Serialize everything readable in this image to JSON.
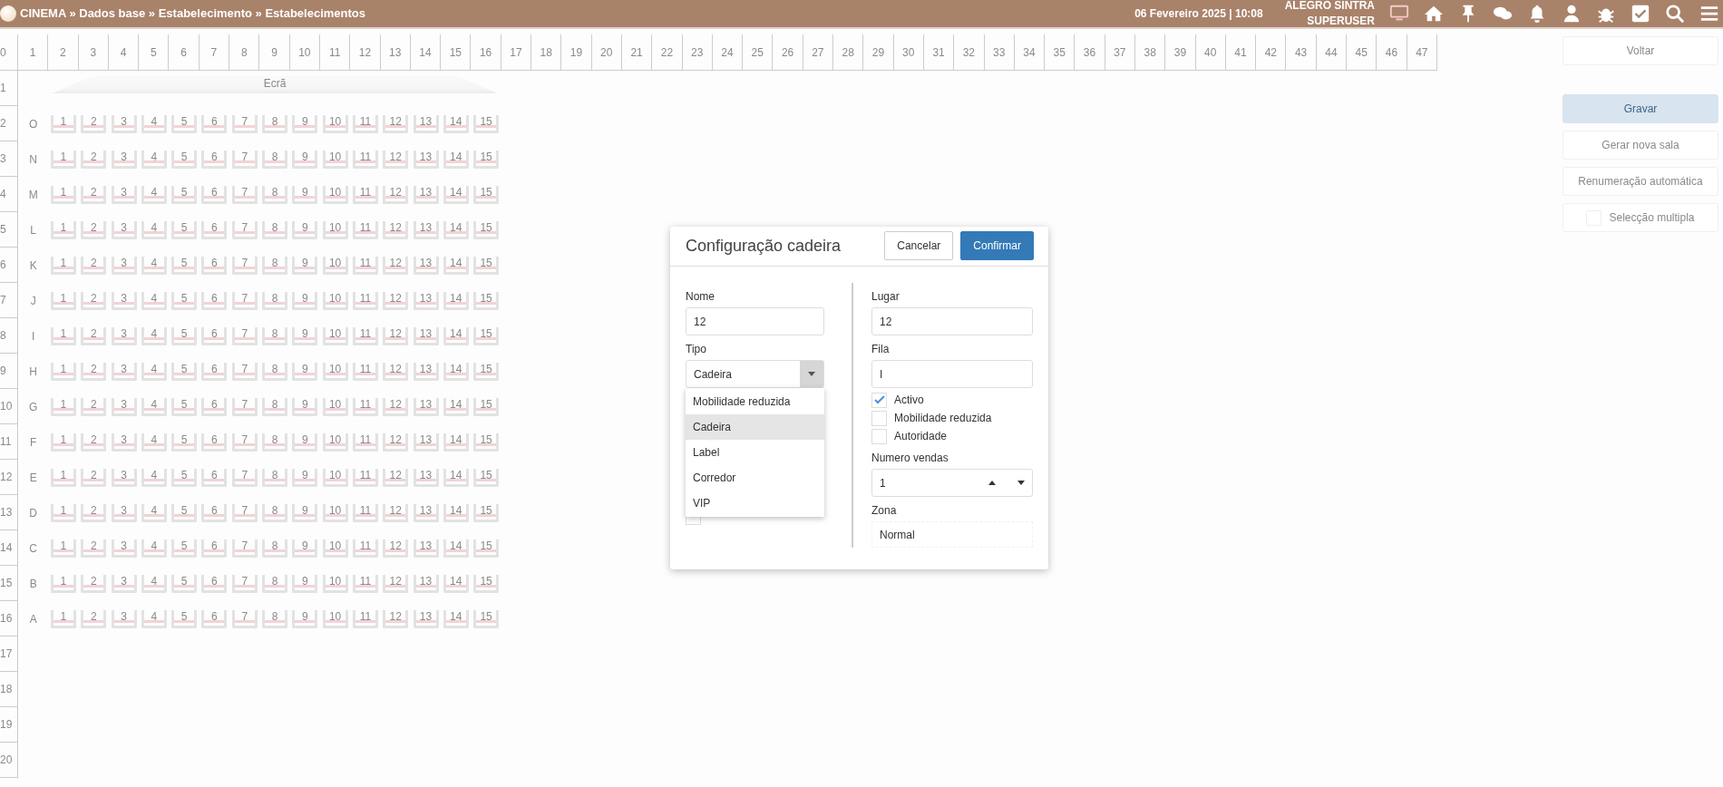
{
  "topbar": {
    "breadcrumb": "CINEMA » Dados base » Estabelecimento » Estabelecimentos",
    "datetime": "06 Fevereiro 2025 | 10:08",
    "user": "ALEGRO SINTRA",
    "role": "SUPERUSER"
  },
  "column_ruler": [
    "0",
    "1",
    "2",
    "3",
    "4",
    "5",
    "6",
    "7",
    "8",
    "9",
    "10",
    "11",
    "12",
    "13",
    "14",
    "15",
    "16",
    "17",
    "18",
    "19",
    "20",
    "21",
    "22",
    "23",
    "24",
    "25",
    "26",
    "27",
    "28",
    "29",
    "30",
    "31",
    "32",
    "33",
    "34",
    "35",
    "36",
    "37",
    "38",
    "39",
    "40",
    "41",
    "42",
    "43",
    "44",
    "45",
    "46",
    "47"
  ],
  "row_ruler": [
    "1",
    "2",
    "3",
    "4",
    "5",
    "6",
    "7",
    "8",
    "9",
    "10",
    "11",
    "12",
    "13",
    "14",
    "15",
    "16",
    "17",
    "18",
    "19",
    "20"
  ],
  "screen_label": "Ecrã",
  "seat_rows": [
    {
      "label": "O",
      "seats": [
        "1",
        "2",
        "3",
        "4",
        "5",
        "6",
        "7",
        "8",
        "9",
        "10",
        "11",
        "12",
        "13",
        "14",
        "15"
      ]
    },
    {
      "label": "N",
      "seats": [
        "1",
        "2",
        "3",
        "4",
        "5",
        "6",
        "7",
        "8",
        "9",
        "10",
        "11",
        "12",
        "13",
        "14",
        "15"
      ]
    },
    {
      "label": "M",
      "seats": [
        "1",
        "2",
        "3",
        "4",
        "5",
        "6",
        "7",
        "8",
        "9",
        "10",
        "11",
        "12",
        "13",
        "14",
        "15"
      ]
    },
    {
      "label": "L",
      "seats": [
        "1",
        "2",
        "3",
        "4",
        "5",
        "6",
        "7",
        "8",
        "9",
        "10",
        "11",
        "12",
        "13",
        "14",
        "15"
      ]
    },
    {
      "label": "K",
      "seats": [
        "1",
        "2",
        "3",
        "4",
        "5",
        "6",
        "7",
        "8",
        "9",
        "10",
        "11",
        "12",
        "13",
        "14",
        "15"
      ]
    },
    {
      "label": "J",
      "seats": [
        "1",
        "2",
        "3",
        "4",
        "5",
        "6",
        "7",
        "8",
        "9",
        "10",
        "11",
        "12",
        "13",
        "14",
        "15"
      ]
    },
    {
      "label": "I",
      "seats": [
        "1",
        "2",
        "3",
        "4",
        "5",
        "6",
        "7",
        "8",
        "9",
        "10",
        "11",
        "12",
        "13",
        "14",
        "15"
      ]
    },
    {
      "label": "H",
      "seats": [
        "1",
        "2",
        "3",
        "4",
        "5",
        "6",
        "7",
        "8",
        "9",
        "10",
        "11",
        "12",
        "13",
        "14",
        "15"
      ]
    },
    {
      "label": "G",
      "seats": [
        "1",
        "2",
        "3",
        "4",
        "5",
        "6",
        "7",
        "8",
        "9",
        "10",
        "11",
        "12",
        "13",
        "14",
        "15"
      ]
    },
    {
      "label": "F",
      "seats": [
        "1",
        "2",
        "3",
        "4",
        "5",
        "6",
        "7",
        "8",
        "9",
        "10",
        "11",
        "12",
        "13",
        "14",
        "15"
      ]
    },
    {
      "label": "E",
      "seats": [
        "1",
        "2",
        "3",
        "4",
        "5",
        "6",
        "7",
        "8",
        "9",
        "10",
        "11",
        "12",
        "13",
        "14",
        "15"
      ]
    },
    {
      "label": "D",
      "seats": [
        "1",
        "2",
        "3",
        "4",
        "5",
        "6",
        "7",
        "8",
        "9",
        "10",
        "11",
        "12",
        "13",
        "14",
        "15"
      ]
    },
    {
      "label": "C",
      "seats": [
        "1",
        "2",
        "3",
        "4",
        "5",
        "6",
        "7",
        "8",
        "9",
        "10",
        "11",
        "12",
        "13",
        "14",
        "15"
      ]
    },
    {
      "label": "B",
      "seats": [
        "1",
        "2",
        "3",
        "4",
        "5",
        "6",
        "7",
        "8",
        "9",
        "10",
        "11",
        "12",
        "13",
        "14",
        "15"
      ]
    },
    {
      "label": "A",
      "seats": [
        "1",
        "2",
        "3",
        "4",
        "5",
        "6",
        "7",
        "8",
        "9",
        "10",
        "11",
        "12",
        "13",
        "14",
        "15"
      ]
    }
  ],
  "side_buttons": [
    {
      "kind": "button",
      "label": "Voltar"
    },
    {
      "kind": "primary",
      "label": "Gravar"
    },
    {
      "kind": "button",
      "label": "Gerar nova sala"
    },
    {
      "kind": "button",
      "label": "Renumeração automática"
    },
    {
      "kind": "checkbox",
      "label": "Selecção multipla",
      "checked": false
    }
  ],
  "dialog": {
    "title": "Configuração cadeira",
    "cancel": "Cancelar",
    "confirm": "Confirmar",
    "nome": {
      "label": "Nome",
      "value": "12"
    },
    "tipo": {
      "label": "Tipo",
      "value": "Cadeira",
      "expanded": true,
      "options": [
        {
          "label": "Mobilidade reduzida",
          "selected": false
        },
        {
          "label": "Cadeira",
          "selected": true
        },
        {
          "label": "Label",
          "selected": false
        },
        {
          "label": "Corredor",
          "selected": false
        },
        {
          "label": "VIP",
          "selected": false
        }
      ]
    },
    "renumeracao": {
      "checked": false
    },
    "lugar": {
      "label": "Lugar",
      "value": "12"
    },
    "fila": {
      "label": "Fila",
      "value": "I"
    },
    "flags": [
      {
        "label": "Activo",
        "checked": true
      },
      {
        "label": "Mobilidade reduzida",
        "checked": false
      },
      {
        "label": "Autoridade",
        "checked": false
      }
    ],
    "vendas": {
      "label": "Numero vendas",
      "value": "1"
    },
    "zona": {
      "label": "Zona",
      "value": "Normal"
    }
  }
}
